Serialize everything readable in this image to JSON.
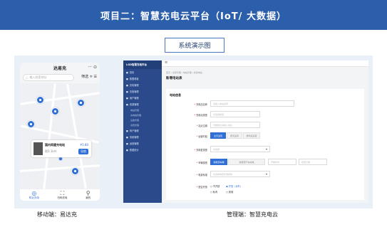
{
  "banner": {
    "title": "项目二：智慧充电云平台（IoT/ 大数据）"
  },
  "demo_label": "系统演示图",
  "captions": {
    "mobile": "移动端：易达充",
    "admin": "管理端：智慧充电云"
  },
  "colors": {
    "brand": "#2b5eab",
    "accent": "#2f6fd6",
    "sidebar": "#2a4a8c"
  },
  "phone": {
    "title": "达易充",
    "title_controls": "··· ⊙",
    "search_placeholder": "输入检索地址",
    "filter": "筛选 ≑ ☰",
    "card": {
      "name": "国内同建充电站",
      "distance": "距0.1km",
      "price": "¥1.80",
      "button": "导航"
    },
    "nav": [
      {
        "label": "附近充电",
        "icon": "location-icon"
      },
      {
        "label": "扫码充电",
        "icon": "scan-icon"
      },
      {
        "label": "我的",
        "icon": "user-icon"
      }
    ]
  },
  "admin": {
    "logo": "LGD智慧充电平台",
    "topbar": "≡",
    "sidebar": [
      {
        "label": "首页"
      },
      {
        "label": "数据看板"
      },
      {
        "label": "充电管理"
      },
      {
        "label": "充值管理"
      },
      {
        "label": "用户管理"
      },
      {
        "label": "资源管理"
      }
    ],
    "sidebar_sub": [
      "电站管理",
      "充电桩管理",
      "设备管理",
      "资费管理"
    ],
    "sidebar_more": [
      {
        "label": "商户管理"
      },
      {
        "label": "系统管理"
      },
      {
        "label": "运营管理"
      },
      {
        "label": "数据统计"
      }
    ],
    "breadcrumb": "首页 / 资源管理 / 电站管理 / 新建电站",
    "page_title": "新增电站表",
    "section_title": "电站信息",
    "fields": [
      {
        "label": "充电站名称",
        "placeholder": "请输入电站名称"
      },
      {
        "label": "充电站类型",
        "placeholder": "请选择类型"
      },
      {
        "label": "站点位置",
        "placeholder": "详细地址请输入地址"
      },
      {
        "label": "运营时段",
        "options": [
          "全天运营",
          "按天运营",
          "按时段运营"
        ]
      },
      {
        "label": "充电桩类型",
        "placeholder": "请选择"
      },
      {
        "label": "车辆类型",
        "options": [
          "新能源车辆",
          "新能源汽车充电"
        ],
        "extra_a": "开始时间",
        "extra_b": "结束日期"
      },
      {
        "label": "电费标准",
        "placeholder": "请选择电费标准模版"
      },
      {
        "label": "是否开放",
        "radios": [
          "不开放",
          "开放（对外）",
          "私有",
          "其他"
        ]
      }
    ]
  }
}
